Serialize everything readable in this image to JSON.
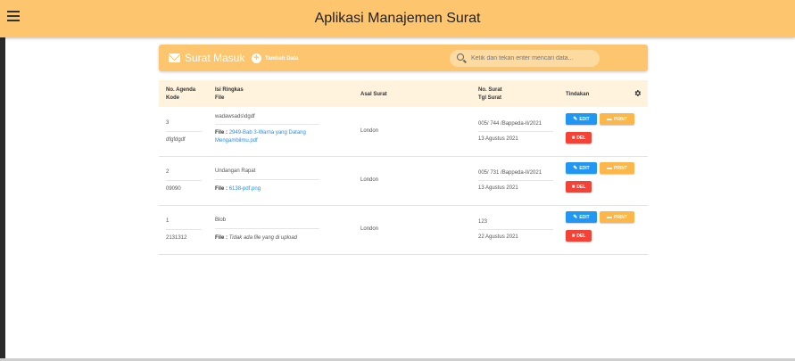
{
  "app": {
    "title": "Aplikasi Manajemen Surat"
  },
  "card": {
    "title": "Surat Masuk",
    "add_label": "Tambah Data",
    "search_placeholder": "Ketik dan tekan enter mencari data..."
  },
  "table": {
    "headers": {
      "agenda": "No. Agenda",
      "kode": "Kode",
      "isi": "Isi Ringkas",
      "file": "File",
      "asal": "Asal Surat",
      "no_surat": "No. Surat",
      "tgl_surat": "Tgl Surat",
      "tindakan": "Tindakan"
    },
    "rows": [
      {
        "agenda": "3",
        "kode": "dfgfdgdf",
        "isi": "wadawsads\\dgdf",
        "file_label": "File :",
        "file_name": "2949-Bab 3-Warna yang Datang Mengambilmu.pdf",
        "asal": "London",
        "no_surat": "005/ 744 /Bappeda-II/2021",
        "tgl_surat": "13 Agustus 2021"
      },
      {
        "agenda": "2",
        "kode": "09090",
        "isi": "Undangan Rapat",
        "file_label": "File :",
        "file_name": "6138-pdf.png",
        "asal": "London",
        "no_surat": "005/ 731 /Bappeda-II/2021",
        "tgl_surat": "13 Agustus 2021"
      },
      {
        "agenda": "1",
        "kode": "2131312",
        "isi": "Blob",
        "file_label": "File :",
        "file_name": "Tidak ada file yang di upload",
        "asal": "London",
        "no_surat": "123",
        "tgl_surat": "22 Agustus 2021"
      }
    ],
    "actions": {
      "edit": "EDIT",
      "print": "PRINT",
      "del": "DEL"
    }
  },
  "colors": {
    "accent": "#fdc56d",
    "edit": "#2196f3",
    "print": "#fdb64a",
    "del": "#f44336",
    "link": "#2b8be6"
  },
  "icons": {
    "menu": "hamburger-icon",
    "mail": "mail-icon",
    "add": "plus-circle-icon",
    "search": "search-icon",
    "settings": "gear-icon"
  }
}
